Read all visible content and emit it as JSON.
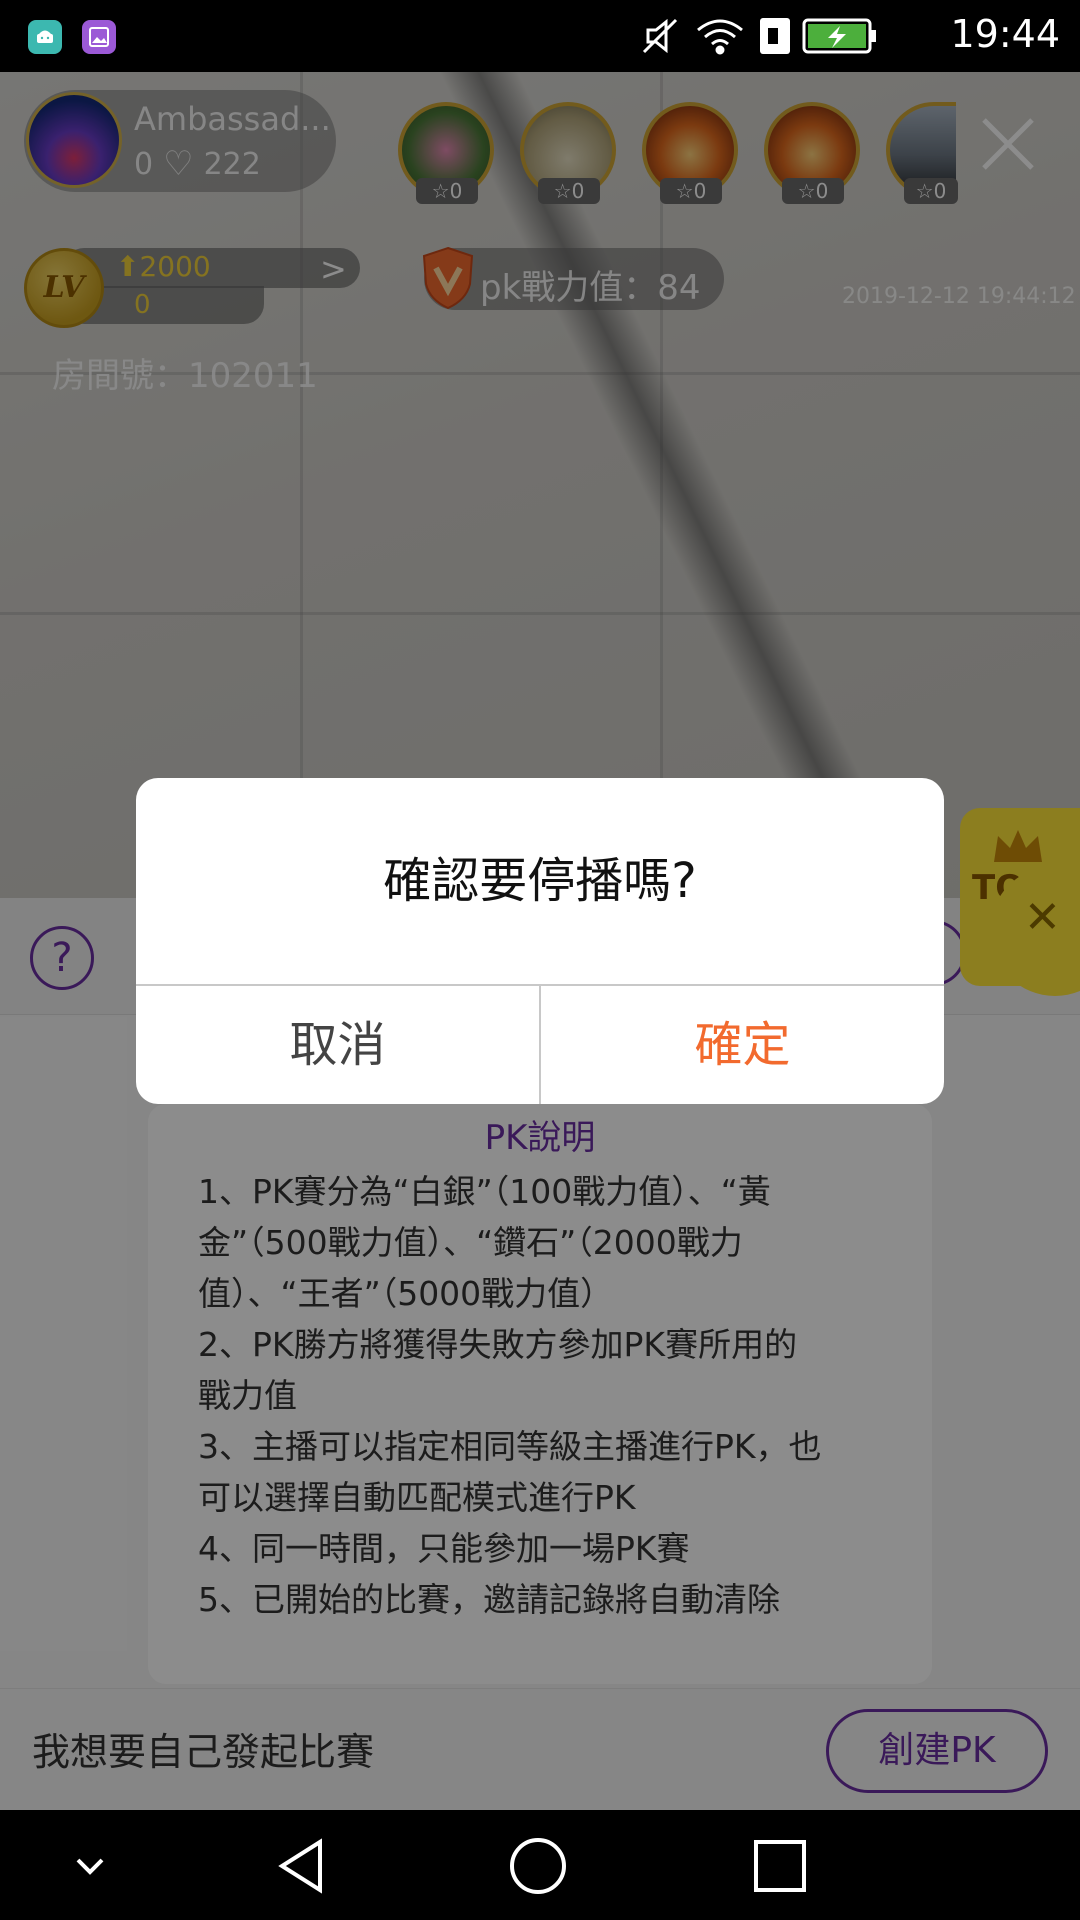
{
  "status_bar": {
    "time": "19:44",
    "icons": [
      "android-icon",
      "gallery-icon",
      "mute-icon",
      "wifi-icon",
      "sim-icon",
      "battery-charging-icon"
    ]
  },
  "live": {
    "host": {
      "name": "Ambassad...",
      "likes_prefix": "0",
      "likes": "222"
    },
    "viewer_badges": [
      "0",
      "0",
      "0",
      "0",
      "0"
    ],
    "level": {
      "points": "2000",
      "sub": "0",
      "coin_label": "LV"
    },
    "pk_power": "pk戰力值：84",
    "timestamp": "2019-12-12 19:44:12",
    "room_number": "房間號：102011"
  },
  "pk_panel": {
    "help_label": "?",
    "rules_title": "PK說明",
    "rules": [
      "1、PK賽分為“白銀”（100戰力值）、“黃\n金”（500戰力值）、“鑽石”（2000戰力\n值）、“王者”（5000戰力值）",
      "2、PK勝方將獲得失敗方參加PK賽所用的\n戰力值",
      "3、主播可以指定相同等級主播進行PK，也\n可以選擇自動匹配模式進行PK",
      "4、同一時間，只能參加一場PK賽",
      "5、已開始的比賽，邀請記錄將自動清除"
    ],
    "self_start_label": "我想要自己發起比賽",
    "create_button": "創建PK"
  },
  "top_tab": {
    "label": "TOP"
  },
  "dialog": {
    "title": "確認要停播嗎?",
    "cancel": "取消",
    "confirm": "確定"
  },
  "colors": {
    "accent_purple": "#6b2fa3",
    "confirm_orange": "#f26a2e",
    "gold": "#f3d23b",
    "top_yellow": "#ffe53a"
  }
}
